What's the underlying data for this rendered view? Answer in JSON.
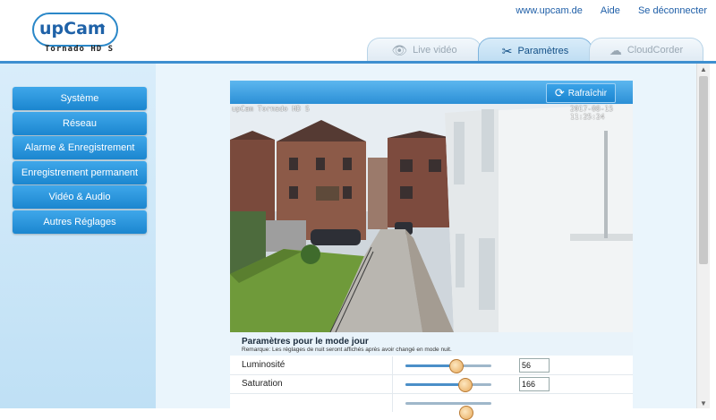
{
  "header": {
    "logo_text": "upCam",
    "logo_model": "Tornado HD S",
    "links": [
      "www.upcam.de",
      "Aide",
      "Se déconnecter"
    ]
  },
  "tabs": [
    {
      "label": "Live vidéo",
      "icon": "eye-icon",
      "active": false
    },
    {
      "label": "Paramètres",
      "icon": "tools-icon",
      "active": true
    },
    {
      "label": "CloudCorder",
      "icon": "cloud-recorder-icon",
      "active": false
    }
  ],
  "sidebar": {
    "items": [
      {
        "label": "Système"
      },
      {
        "label": "Réseau"
      },
      {
        "label": "Alarme & Enregistrement"
      },
      {
        "label": "Enregistrement permanent"
      },
      {
        "label": "Vidéo & Audio"
      },
      {
        "label": "Autres Réglages"
      }
    ]
  },
  "toolbar": {
    "refresh_label": "Rafraîchir"
  },
  "camera": {
    "osd_name": "upCam Tornado HD S",
    "osd_time": "2017-08-15 11:25:24"
  },
  "settings": {
    "title": "Paramètres pour le mode jour",
    "note": "Remarque: Les réglages de nuit seront affichés après avoir changé en mode nuit.",
    "rows": [
      {
        "label": "Luminosité",
        "value": "56",
        "slider_fraction": 0.58
      },
      {
        "label": "Saturation",
        "value": "166",
        "slider_fraction": 0.69
      }
    ]
  },
  "colors": {
    "accent": "#1b86cf",
    "link": "#1f5fa8"
  }
}
